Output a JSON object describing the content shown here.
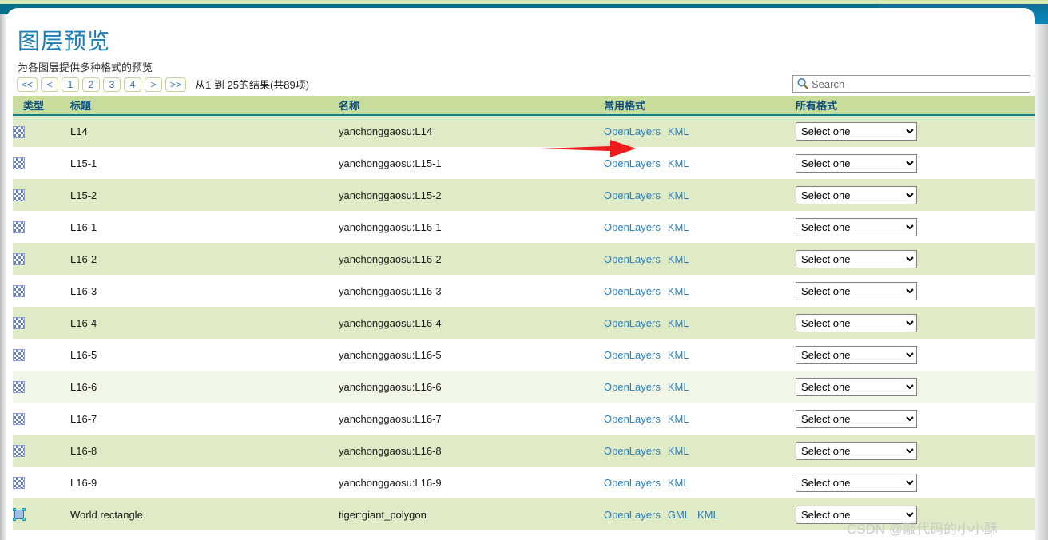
{
  "header": {
    "title": "图层预览",
    "subtitle": "为各图层提供多种格式的预览"
  },
  "colors": {
    "top_strip": "#d7e5b0",
    "top_bar": "#006f8a",
    "title_blue": "#1a7fb8",
    "table_header_green": "#c8dd9b",
    "row_even_green": "#dfeac6",
    "link_blue": "#2a7fbd",
    "arrow_red": "#ee1c1c"
  },
  "pager": {
    "buttons": [
      {
        "label": "<<",
        "name": "first"
      },
      {
        "label": "<",
        "name": "prev"
      },
      {
        "label": "1",
        "name": "page-1"
      },
      {
        "label": "2",
        "name": "page-2"
      },
      {
        "label": "3",
        "name": "page-3"
      },
      {
        "label": "4",
        "name": "page-4"
      },
      {
        "label": ">",
        "name": "next"
      },
      {
        "label": ">>",
        "name": "last"
      }
    ],
    "info": "从1 到 25的结果(共89项)"
  },
  "search": {
    "placeholder": "Search",
    "value": "",
    "icon": "search-icon"
  },
  "table": {
    "columns": [
      {
        "key": "type",
        "label": "类型"
      },
      {
        "key": "title",
        "label": "标题"
      },
      {
        "key": "name",
        "label": "名称"
      },
      {
        "key": "common",
        "label": "常用格式"
      },
      {
        "key": "all",
        "label": "所有格式"
      }
    ],
    "select_placeholder": "Select one",
    "rows": [
      {
        "icon": "raster-layer-icon",
        "title": "L14",
        "name": "yanchonggaosu:L14",
        "formats": [
          "OpenLayers",
          "KML"
        ],
        "select": "Select one"
      },
      {
        "icon": "raster-layer-icon",
        "title": "L15-1",
        "name": "yanchonggaosu:L15-1",
        "formats": [
          "OpenLayers",
          "KML"
        ],
        "select": "Select one"
      },
      {
        "icon": "raster-layer-icon",
        "title": "L15-2",
        "name": "yanchonggaosu:L15-2",
        "formats": [
          "OpenLayers",
          "KML"
        ],
        "select": "Select one"
      },
      {
        "icon": "raster-layer-icon",
        "title": "L16-1",
        "name": "yanchonggaosu:L16-1",
        "formats": [
          "OpenLayers",
          "KML"
        ],
        "select": "Select one"
      },
      {
        "icon": "raster-layer-icon",
        "title": "L16-2",
        "name": "yanchonggaosu:L16-2",
        "formats": [
          "OpenLayers",
          "KML"
        ],
        "select": "Select one"
      },
      {
        "icon": "raster-layer-icon",
        "title": "L16-3",
        "name": "yanchonggaosu:L16-3",
        "formats": [
          "OpenLayers",
          "KML"
        ],
        "select": "Select one"
      },
      {
        "icon": "raster-layer-icon",
        "title": "L16-4",
        "name": "yanchonggaosu:L16-4",
        "formats": [
          "OpenLayers",
          "KML"
        ],
        "select": "Select one"
      },
      {
        "icon": "raster-layer-icon",
        "title": "L16-5",
        "name": "yanchonggaosu:L16-5",
        "formats": [
          "OpenLayers",
          "KML"
        ],
        "select": "Select one"
      },
      {
        "icon": "raster-layer-icon",
        "title": "L16-6",
        "name": "yanchonggaosu:L16-6",
        "formats": [
          "OpenLayers",
          "KML"
        ],
        "select": "Select one"
      },
      {
        "icon": "raster-layer-icon",
        "title": "L16-7",
        "name": "yanchonggaosu:L16-7",
        "formats": [
          "OpenLayers",
          "KML"
        ],
        "select": "Select one"
      },
      {
        "icon": "raster-layer-icon",
        "title": "L16-8",
        "name": "yanchonggaosu:L16-8",
        "formats": [
          "OpenLayers",
          "KML"
        ],
        "select": "Select one"
      },
      {
        "icon": "raster-layer-icon",
        "title": "L16-9",
        "name": "yanchonggaosu:L16-9",
        "formats": [
          "OpenLayers",
          "KML"
        ],
        "select": "Select one"
      },
      {
        "icon": "polygon-layer-icon",
        "title": "World rectangle",
        "name": "tiger:giant_polygon",
        "formats": [
          "OpenLayers",
          "GML",
          "KML"
        ],
        "select": "Select one"
      }
    ]
  },
  "annotation": {
    "arrow": "red-arrow-pointing-right"
  },
  "watermark": {
    "text": "CSDN @敲代码的小小酥"
  }
}
